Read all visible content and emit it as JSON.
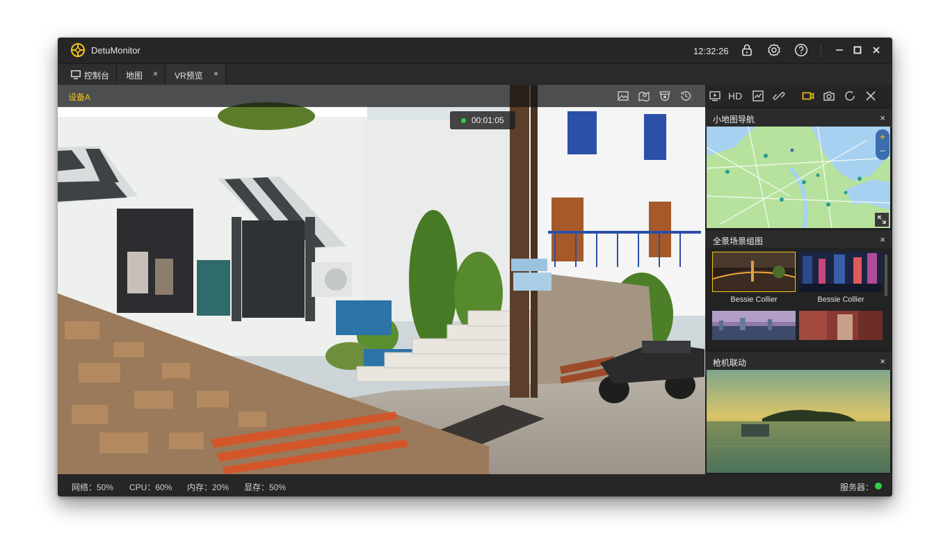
{
  "app": {
    "title": "DetuMonitor",
    "clock": "12:32:26"
  },
  "tabs": [
    {
      "label": "控制台",
      "icon": "monitor-icon",
      "closable": false
    },
    {
      "label": "地图",
      "closable": true,
      "close_glyph": "×"
    },
    {
      "label": "VR预览",
      "closable": true,
      "close_glyph": "×"
    }
  ],
  "viewer": {
    "device_label": "设备A",
    "recording_timer": "00:01:05",
    "toolbar_left": [
      "image-icon",
      "map-marker-icon",
      "camera-dome-icon",
      "history-icon"
    ],
    "toolbar_right": [
      "play-screen-icon",
      "hd-label",
      "chart-icon",
      "link-icon",
      "record-video-icon",
      "snapshot-icon",
      "refresh-icon",
      "close-icon"
    ],
    "hd_text": "HD",
    "active_color": "#f5c518"
  },
  "panels": {
    "minimap": {
      "title": "小地图导航",
      "close": "×",
      "zoom_in": "+",
      "zoom_out": "−"
    },
    "scenes": {
      "title": "全景场景组图",
      "close": "×",
      "items": [
        {
          "caption": "Bessie Collier",
          "selected": true
        },
        {
          "caption": "Bessie Collier",
          "selected": false
        },
        {
          "caption": "",
          "selected": false
        },
        {
          "caption": "",
          "selected": false
        }
      ]
    },
    "bullet": {
      "title": "枪机联动",
      "close": "×"
    }
  },
  "status": {
    "network": "网络：50%",
    "cpu": "CPU：60%",
    "memory": "内存：20%",
    "vram": "显存：50%",
    "server": "服务器：",
    "server_color": "#2fd04a"
  }
}
